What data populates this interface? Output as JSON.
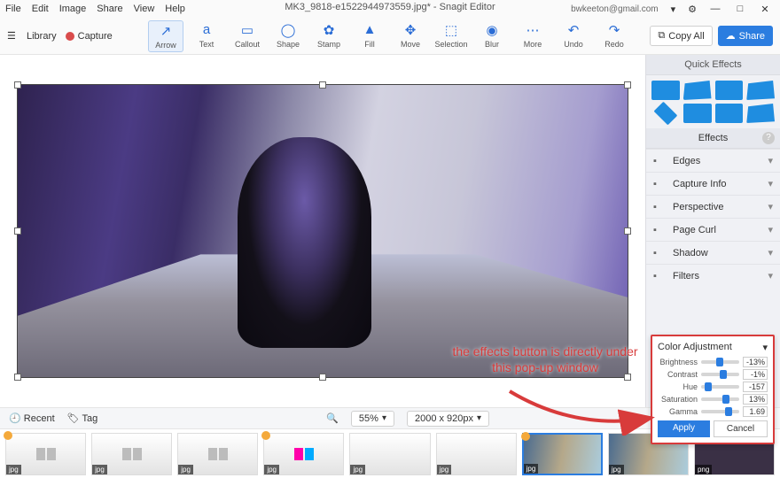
{
  "menu": {
    "file": "File",
    "edit": "Edit",
    "image": "Image",
    "share": "Share",
    "view": "View",
    "help": "Help"
  },
  "title": "MK3_9818-e1522944973559.jpg* - Snagit Editor",
  "win": {
    "email": "bwkeeton@gmail.com",
    "gear": "⚙",
    "min": "—",
    "max": "□",
    "close": "✕",
    "dd": "▾"
  },
  "bar": {
    "library": "Library",
    "capture": "Capture",
    "copyall": "Copy All",
    "share": "Share"
  },
  "tools": [
    {
      "n": "Arrow",
      "i": "↗"
    },
    {
      "n": "Text",
      "i": "a"
    },
    {
      "n": "Callout",
      "i": "▭"
    },
    {
      "n": "Shape",
      "i": "◯"
    },
    {
      "n": "Stamp",
      "i": "✿"
    },
    {
      "n": "Fill",
      "i": "▲"
    },
    {
      "n": "Move",
      "i": "✥"
    },
    {
      "n": "Selection",
      "i": "⬚"
    },
    {
      "n": "Blur",
      "i": "◉"
    },
    {
      "n": "More",
      "i": "⋯"
    },
    {
      "n": "Undo",
      "i": "↶"
    },
    {
      "n": "Redo",
      "i": "↷"
    }
  ],
  "qe_header": "Quick Effects",
  "eff_header": "Effects",
  "effects": [
    "Edges",
    "Capture Info",
    "Perspective",
    "Page Curl",
    "Shadow",
    "Filters"
  ],
  "zoom": "55%",
  "dims": "2000 x 920px",
  "recent": "Recent",
  "tag": "Tag",
  "popup": {
    "title": "Color Adjustment",
    "rows": [
      {
        "l": "Brightness",
        "v": "-13%",
        "k": 40
      },
      {
        "l": "Contrast",
        "v": "-1%",
        "k": 49
      },
      {
        "l": "Hue",
        "v": "-157",
        "k": 10
      },
      {
        "l": "Saturation",
        "v": "13%",
        "k": 56
      },
      {
        "l": "Gamma",
        "v": "1.69",
        "k": 62
      }
    ],
    "apply": "Apply",
    "cancel": "Cancel"
  },
  "annotation": "the effects button is directly under this pop-up window",
  "thumb_label": "jpg",
  "thumb_label_png": "png"
}
